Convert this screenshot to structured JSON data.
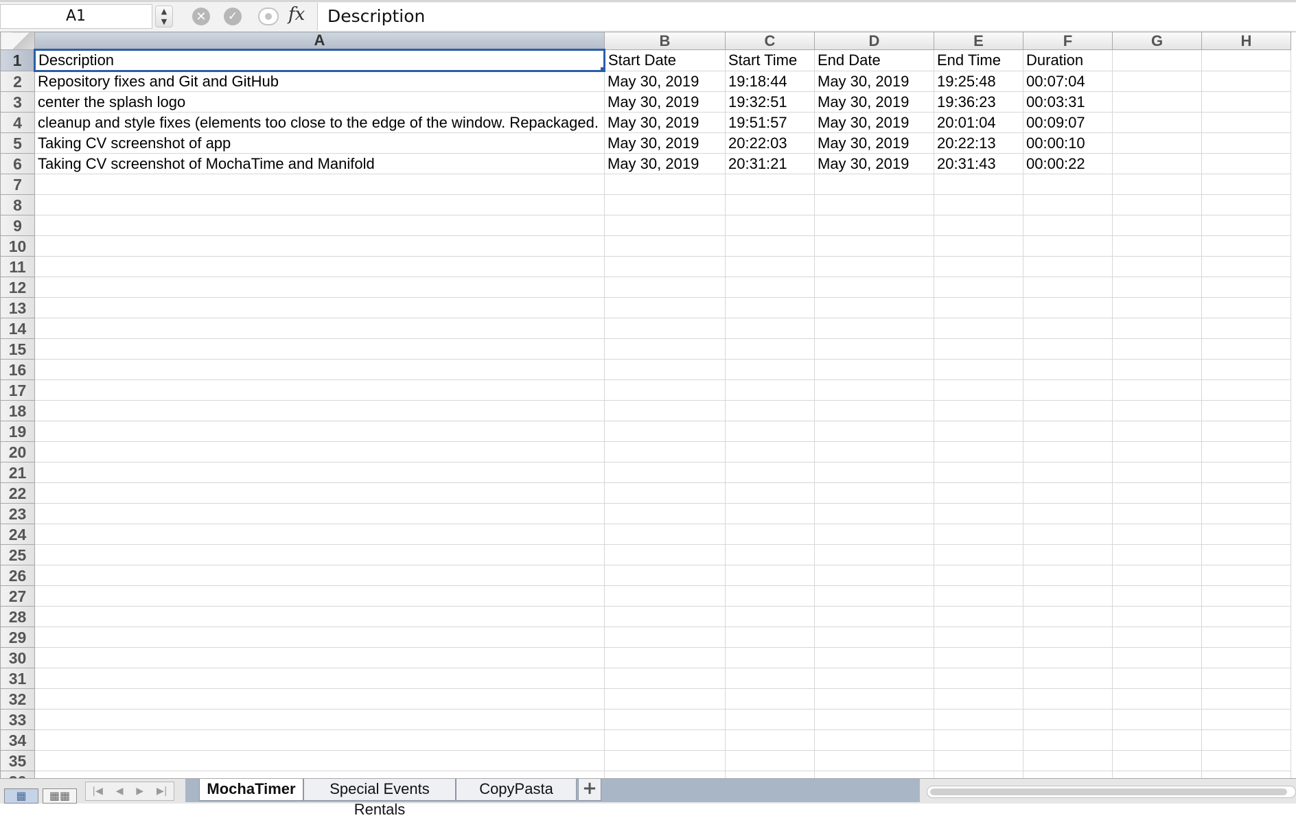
{
  "formula_bar": {
    "cell_ref": "A1",
    "formula": "Description",
    "fx_label": "fx"
  },
  "columns": [
    "A",
    "B",
    "C",
    "D",
    "E",
    "F",
    "G",
    "H"
  ],
  "rows": [
    [
      "Description",
      "Start Date",
      "Start Time",
      "End Date",
      "End Time",
      "Duration",
      "",
      ""
    ],
    [
      "Repository fixes and Git and GitHub",
      "May 30, 2019",
      "19:18:44",
      "May 30, 2019",
      "19:25:48",
      "00:07:04",
      "",
      ""
    ],
    [
      "center the splash logo",
      "May 30, 2019",
      "19:32:51",
      "May 30, 2019",
      "19:36:23",
      "00:03:31",
      "",
      ""
    ],
    [
      "cleanup and style fixes (elements too close to the edge of the window. Repackaged.",
      "May 30, 2019",
      "19:51:57",
      "May 30, 2019",
      "20:01:04",
      "00:09:07",
      "",
      ""
    ],
    [
      "Taking CV screenshot of app",
      "May 30, 2019",
      "20:22:03",
      "May 30, 2019",
      "20:22:13",
      "00:00:10",
      "",
      ""
    ],
    [
      "Taking CV screenshot of MochaTime and Manifold",
      "May 30, 2019",
      "20:31:21",
      "May 30, 2019",
      "20:31:43",
      "00:00:22",
      "",
      ""
    ]
  ],
  "total_visible_rows": 36,
  "sheet_tabs": [
    {
      "label": "MochaTimer",
      "active": true
    },
    {
      "label": "Special Events Rentals",
      "active": false
    },
    {
      "label": "CopyPasta",
      "active": false
    }
  ],
  "add_sheet_label": "+",
  "nav_icons": [
    "first-sheet-icon",
    "prev-sheet-icon",
    "next-sheet-icon",
    "last-sheet-icon"
  ]
}
